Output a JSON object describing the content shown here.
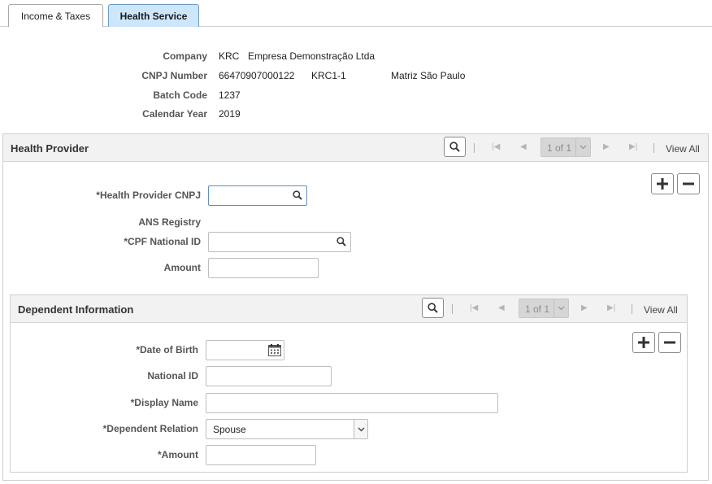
{
  "tabs": [
    {
      "label": "Income & Taxes"
    },
    {
      "label": "Health Service"
    }
  ],
  "header": {
    "company_label": "Company",
    "company_code": "KRC",
    "company_name": "Empresa Demonstração Ltda",
    "cnpj_label": "CNPJ Number",
    "cnpj_value": "66470907000122",
    "cnpj_code": "KRC1-1",
    "cnpj_location": "Matriz São Paulo",
    "batch_label": "Batch Code",
    "batch_value": "1237",
    "year_label": "Calendar Year",
    "year_value": "2019"
  },
  "health_provider": {
    "title": "Health Provider",
    "pager": "1 of 1",
    "view_all": "View All",
    "provider_cnpj_label": "*Health Provider CNPJ",
    "provider_cnpj_value": "",
    "ans_label": "ANS Registry",
    "cpf_label": "*CPF National ID",
    "cpf_value": "",
    "amount_label": "Amount",
    "amount_value": ""
  },
  "dependent": {
    "title": "Dependent Information",
    "pager": "1 of 1",
    "view_all": "View All",
    "dob_label": "*Date of Birth",
    "dob_value": "",
    "national_id_label": "National ID",
    "national_id_value": "",
    "display_name_label": "*Display Name",
    "display_name_value": "",
    "relation_label": "*Dependent Relation",
    "relation_value": "Spouse",
    "amount_label": "*Amount",
    "amount_value": ""
  },
  "colors": {
    "active_tab_bg": "#cde6fb",
    "section_head_bg": "#f2f2f2",
    "pager_bg": "#d6d6d6"
  },
  "icons": [
    "search-icon",
    "first-page-icon",
    "previous-page-icon",
    "next-page-icon",
    "last-page-icon",
    "chevron-down-icon",
    "plus-icon",
    "minus-icon",
    "calendar-icon"
  ]
}
